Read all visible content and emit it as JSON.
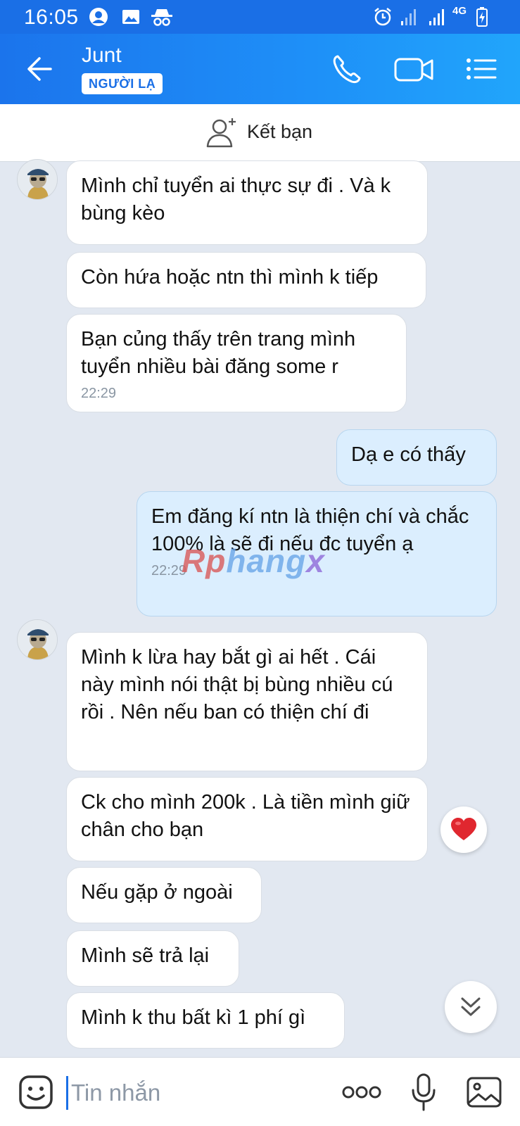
{
  "status_bar": {
    "time": "16:05",
    "network": "4G",
    "left_icons": [
      "avatar-notification-icon",
      "gallery-icon",
      "incognito-icon"
    ],
    "right_icons": [
      "alarm-icon",
      "signal-icon",
      "signal-icon",
      "network-4g-icon",
      "battery-charging-icon"
    ]
  },
  "header": {
    "contact_name": "Junt",
    "badge": "NGƯỜI LẠ",
    "icons": [
      "back-arrow-icon",
      "phone-icon",
      "video-call-icon",
      "menu-list-icon"
    ]
  },
  "friend_bar": {
    "label": "Kết bạn",
    "icon": "add-friend-icon"
  },
  "messages": [
    {
      "text": "Mình chỉ tuyển ai thực sự đi . Và k bùng kèo",
      "direction": "in"
    },
    {
      "text": "Còn hứa hoặc ntn thì mình k tiếp",
      "direction": "in"
    },
    {
      "text": "Bạn củng thấy trên trang mình tuyển nhiều bài đăng some r",
      "time": "22:29",
      "direction": "in"
    },
    {
      "text": "Dạ e có thấy",
      "direction": "out"
    },
    {
      "text": "Em đăng kí ntn là thiện chí và chắc 100% là sẽ đi nếu đc tuyển ạ",
      "time": "22:29",
      "direction": "out"
    },
    {
      "text": "Mình k lừa hay bắt gì ai hết . Cái này mình nói thật bị bùng nhiều cú rồi . Nên nếu ban có thiện chí đi",
      "direction": "in"
    },
    {
      "text": "Ck cho mình 200k . Là tiền mình giữ chân cho bạn",
      "direction": "in",
      "reaction": "heart-icon"
    },
    {
      "text": "Nếu gặp ở ngoài",
      "direction": "in"
    },
    {
      "text": "Mình sẽ trả lại",
      "direction": "in"
    },
    {
      "text": "Mình k thu bất kì 1 phí gì",
      "direction": "in"
    }
  ],
  "watermark": {
    "part_a": "Rp",
    "part_b": "hang",
    "part_c": "x"
  },
  "input_bar": {
    "placeholder": "Tin nhắn",
    "icons": [
      "sticker-icon",
      "more-options-icon",
      "microphone-icon",
      "image-icon"
    ]
  },
  "colors": {
    "header_blue": "#1e90f8",
    "chat_background": "#e2e8f1",
    "outgoing_bubble": "#dbeefe",
    "incoming_bubble": "#ffffff",
    "heart_red": "#e0272f"
  }
}
